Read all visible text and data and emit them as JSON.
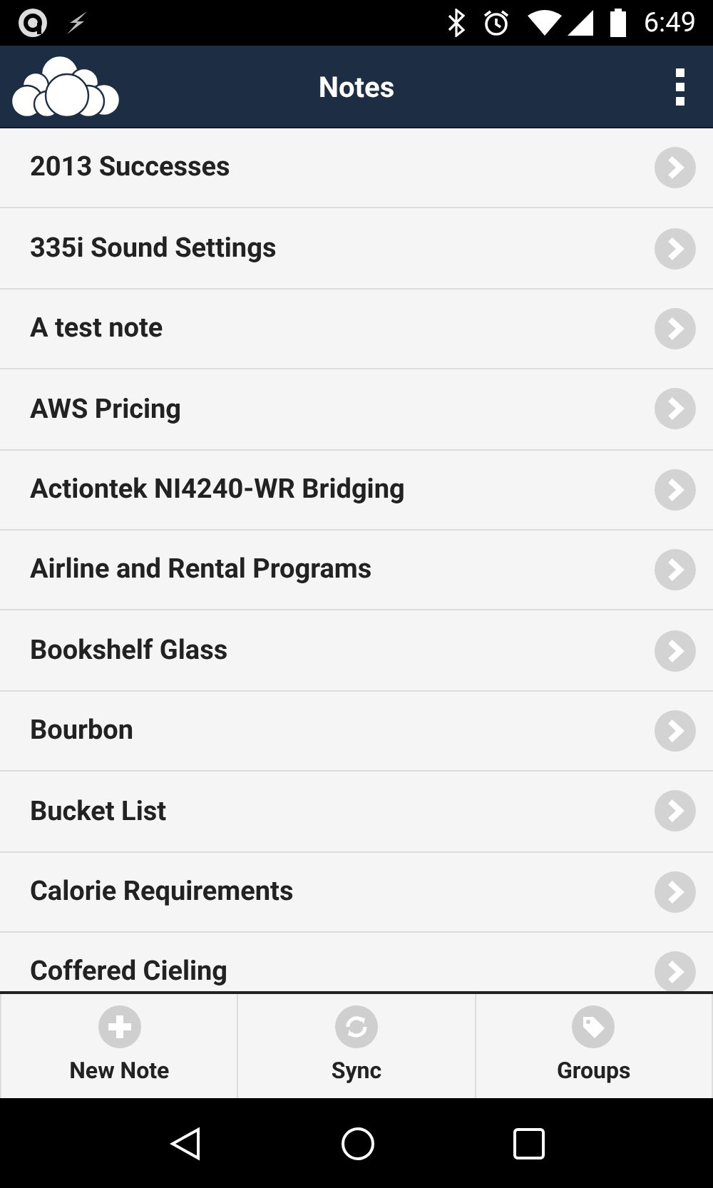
{
  "status_bar": {
    "time": "6:49"
  },
  "header": {
    "title": "Notes"
  },
  "notes": [
    "2013 Successes",
    "335i Sound Settings",
    "A test note",
    "AWS Pricing",
    "Actiontek NI4240-WR Bridging",
    "Airline and Rental Programs",
    "Bookshelf Glass",
    "Bourbon",
    "Bucket List",
    "Calorie Requirements",
    "Coffered Cieling"
  ],
  "toolbar": [
    {
      "kind": "add",
      "label": "New Note"
    },
    {
      "kind": "sync",
      "label": "Sync"
    },
    {
      "kind": "tag",
      "label": "Groups"
    }
  ]
}
